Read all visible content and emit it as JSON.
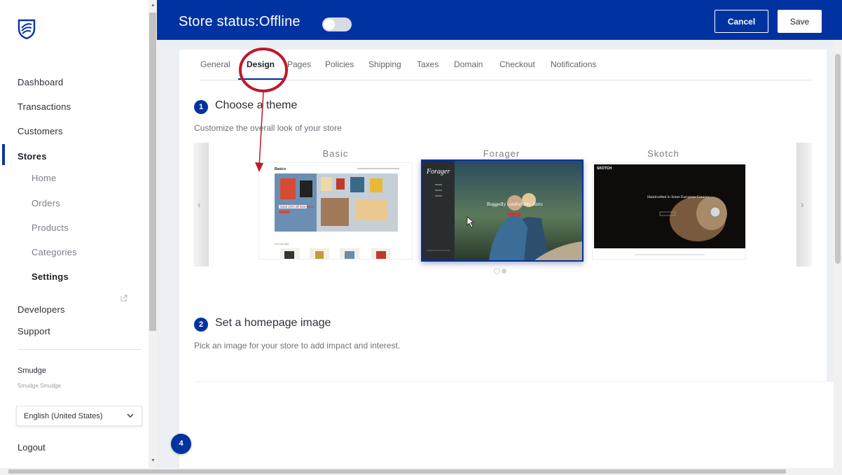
{
  "sidebar": {
    "logo_icon": "bank-shield-logo-icon",
    "items": [
      {
        "label": "Dashboard"
      },
      {
        "label": "Transactions"
      },
      {
        "label": "Customers"
      },
      {
        "label": "Stores"
      },
      {
        "label": "Developers"
      },
      {
        "label": "Support"
      }
    ],
    "store_subitems": [
      {
        "label": "Home"
      },
      {
        "label": "Orders"
      },
      {
        "label": "Products"
      },
      {
        "label": "Categories"
      },
      {
        "label": "Settings"
      }
    ],
    "user": {
      "name": "Smudge",
      "subtitle": "Smudge Smudge"
    },
    "language": {
      "selected": "English (United States)"
    },
    "logout_label": "Logout",
    "accent_color": "#0b33a8"
  },
  "header": {
    "title": "Store status:Offline",
    "toggle_on": false,
    "cancel_label": "Cancel",
    "save_label": "Save",
    "background_color": "#0033a1"
  },
  "tabs": [
    {
      "label": "General"
    },
    {
      "label": "Design",
      "active": true
    },
    {
      "label": "Pages"
    },
    {
      "label": "Policies"
    },
    {
      "label": "Shipping"
    },
    {
      "label": "Taxes"
    },
    {
      "label": "Domain"
    },
    {
      "label": "Checkout"
    },
    {
      "label": "Notifications"
    }
  ],
  "theme_section": {
    "step": "1",
    "title": "Choose a theme",
    "description": "Customize the overall look of your store",
    "themes": [
      {
        "name": "Basic",
        "preview_heading": "Basics",
        "preview_banner": "Save 10% off new items",
        "preview_sub": "Find the best"
      },
      {
        "name": "Forager",
        "selected": true,
        "preview_logo": "Forager",
        "preview_heading": "Ruggedly comfortable shirts"
      },
      {
        "name": "Skotch",
        "preview_logo": "SKOTCH",
        "preview_heading": "Handcrafted in Some European Country"
      }
    ],
    "page_indicator": {
      "pages": 2,
      "current": 1
    }
  },
  "homepage_section": {
    "step": "2",
    "title": "Set a homepage image",
    "description": "Pick an image for your store to add impact and interest."
  },
  "floating_badge": "4",
  "annotation_color": "#c0182a"
}
